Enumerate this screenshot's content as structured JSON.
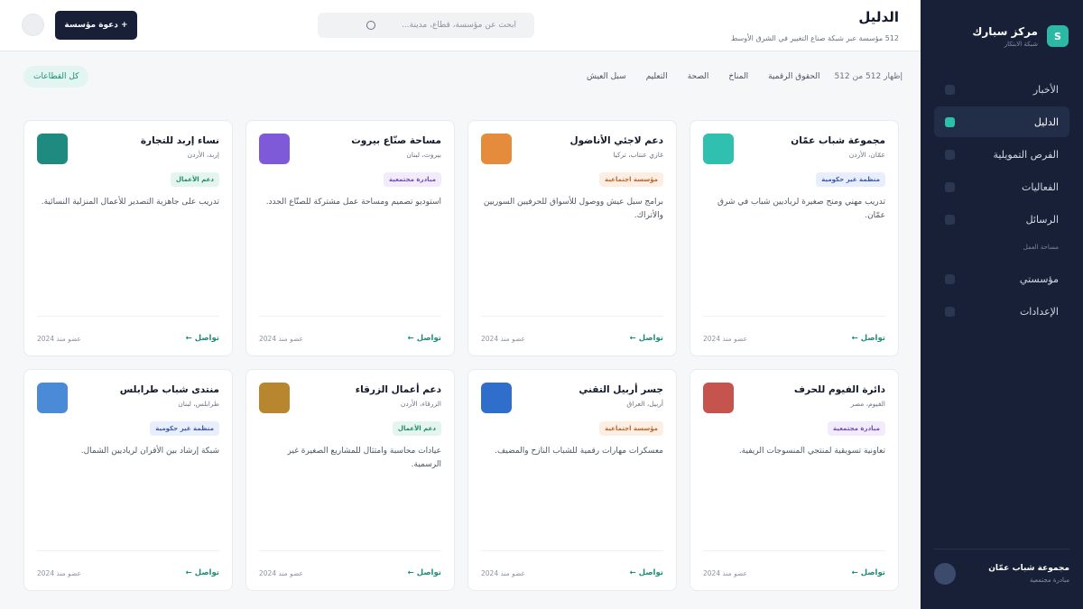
{
  "sidebar": {
    "brand_letter": "S",
    "brand_name": "مركز سبارك",
    "brand_sub": "شبكة الابتكار",
    "items": [
      {
        "label": "الأخبار"
      },
      {
        "label": "الدليل"
      },
      {
        "label": "الفرص التمويلية"
      },
      {
        "label": "الفعاليات"
      },
      {
        "label": "الرسائل"
      }
    ],
    "section_label": "مساحة العمل",
    "workspace_items": [
      {
        "label": "مؤسستي"
      },
      {
        "label": "الإعدادات"
      }
    ],
    "user": {
      "name": "مجموعة شباب عمّان",
      "role": "مبادرة مجتمعية"
    }
  },
  "header": {
    "title": "الدليل",
    "subtitle": "512 مؤسسة عبر شبكة صناع التغيير في الشرق الأوسط",
    "search_placeholder": "ابحث عن مؤسسة، قطاع، مدينة...",
    "invite_label": "+ دعوة مؤسسة"
  },
  "filters": {
    "count": "إظهار 512 من 512",
    "chips": [
      {
        "label": "الحقوق الرقمية"
      },
      {
        "label": "المناخ"
      },
      {
        "label": "الصحة"
      },
      {
        "label": "التعليم"
      },
      {
        "label": "سبل العيش"
      },
      {
        "label": "كل القطاعات"
      }
    ]
  },
  "cards": [
    {
      "name": "مجموعة شباب عمّان",
      "location": "عمّان، الأردن",
      "tag": "منظمة غير حكومية",
      "desc": "تدريب مهني ومنح صغيرة لرياديين شباب في شرق عمّان.",
      "link": "تواصل ←",
      "since": "عضو منذ 2024",
      "avatar_color": "#2fc0b0",
      "tag_bg": "#e8eefb",
      "tag_fg": "#3b5bb0"
    },
    {
      "name": "دعم لاجئي الأناضول",
      "location": "غازي عنتاب، تركيا",
      "tag": "مؤسسة اجتماعية",
      "desc": "برامج سبل عيش ووصول للأسواق للحرفيين السوريين والأتراك.",
      "link": "تواصل ←",
      "since": "عضو منذ 2024",
      "avatar_color": "#e58b3c",
      "tag_bg": "#fdeee3",
      "tag_fg": "#c0652a"
    },
    {
      "name": "مساحة صنّاع بيروت",
      "location": "بيروت، لبنان",
      "tag": "مبادرة مجتمعية",
      "desc": "استوديو تصميم ومساحة عمل مشتركة للصنّاع الجدد.",
      "link": "تواصل ←",
      "since": "عضو منذ 2024",
      "avatar_color": "#7f5ad8",
      "tag_bg": "#f1ebfb",
      "tag_fg": "#7448c2"
    },
    {
      "name": "نساء إربد للتجارة",
      "location": "إربد، الأردن",
      "tag": "دعم الأعمال",
      "desc": "تدريب على جاهزية التصدير للأعمال المنزلية النسائية.",
      "link": "تواصل ←",
      "since": "عضو منذ 2024",
      "avatar_color": "#1f8a80",
      "tag_bg": "#e3f5ee",
      "tag_fg": "#1f8a62"
    },
    {
      "name": "دائرة الفيوم للحرف",
      "location": "الفيوم، مصر",
      "tag": "مبادرة مجتمعية",
      "desc": "تعاونية تسويقية لمنتجي المنسوجات الريفية.",
      "link": "تواصل ←",
      "since": "عضو منذ 2024",
      "avatar_color": "#c4544d",
      "tag_bg": "#f1ebfb",
      "tag_fg": "#7448c2"
    },
    {
      "name": "جسر أربيل التقني",
      "location": "أربيل، العراق",
      "tag": "مؤسسة اجتماعية",
      "desc": "معسكرات مهارات رقمية للشباب النازح والمضيف.",
      "link": "تواصل ←",
      "since": "عضو منذ 2024",
      "avatar_color": "#2f6fcb",
      "tag_bg": "#fdeee3",
      "tag_fg": "#c0652a"
    },
    {
      "name": "دعم أعمال الزرقاء",
      "location": "الزرقاء، الأردن",
      "tag": "دعم الأعمال",
      "desc": "عيادات محاسبة وامتثال للمشاريع الصغيرة غير الرسمية.",
      "link": "تواصل ←",
      "since": "عضو منذ 2024",
      "avatar_color": "#b8862e",
      "tag_bg": "#e3f5ee",
      "tag_fg": "#1f8a62"
    },
    {
      "name": "منتدى شباب طرابلس",
      "location": "طرابلس، لبنان",
      "tag": "منظمة غير حكومية",
      "desc": "شبكة إرشاد بين الأقران لرياديين الشمال.",
      "link": "تواصل ←",
      "since": "عضو منذ 2024",
      "avatar_color": "#4a8ad6",
      "tag_bg": "#e8eefb",
      "tag_fg": "#3b5bb0"
    }
  ]
}
